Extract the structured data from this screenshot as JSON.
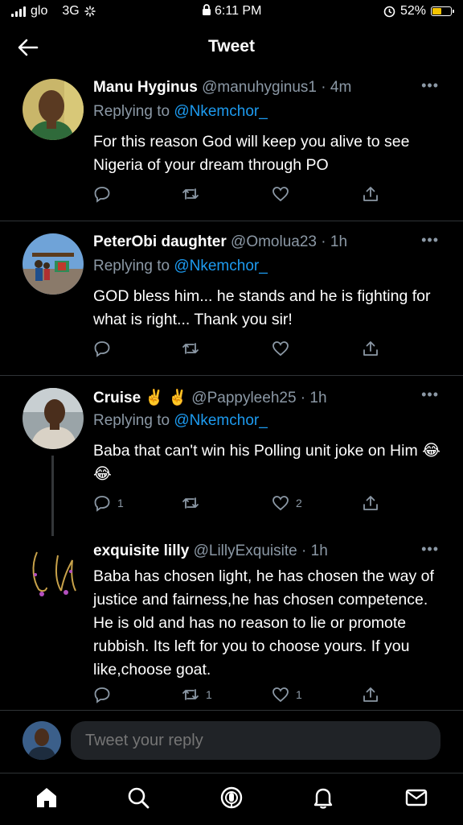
{
  "status": {
    "carrier": "glo",
    "network": "3G",
    "time": "6:11 PM",
    "battery": "52%",
    "battery_level": 0.52
  },
  "header": {
    "title": "Tweet"
  },
  "tweets": [
    {
      "name": "Manu Hyginus",
      "handle": "@manuhyginus1",
      "time": "4m",
      "replying_prefix": "Replying to",
      "replying_to": "@Nkemchor_",
      "text": "For this reason God will keep you alive to see Nigeria of your dream through PO",
      "replies": "",
      "retweets": "",
      "likes": ""
    },
    {
      "name": "PeterObi daughter",
      "handle": "@Omolua23",
      "time": "1h",
      "replying_prefix": "Replying to",
      "replying_to": "@Nkemchor_",
      "text": "GOD bless him... he stands and he is fighting for what is right... Thank you sir!",
      "replies": "",
      "retweets": "",
      "likes": ""
    },
    {
      "name": "Cruise ✌️ ✌️",
      "handle": "@Pappyleeh25",
      "time": "1h",
      "replying_prefix": "Replying to",
      "replying_to": "@Nkemchor_",
      "text": "Baba that can't win his Polling unit joke on Him 😂😂",
      "replies": "1",
      "retweets": "",
      "likes": "2"
    },
    {
      "name": "exquisite lilly",
      "handle": "@LillyExquisite",
      "time": "1h",
      "text": "Baba has chosen light, he has chosen the way of justice and fairness,he has chosen competence. He is old and has no reason to lie or promote rubbish. Its left for you to choose yours. If you like,choose goat.",
      "replies": "",
      "retweets": "1",
      "likes": "1"
    }
  ],
  "reply_box": {
    "placeholder": "Tweet your reply"
  },
  "tabs": [
    "home-icon",
    "search-icon",
    "spaces-icon",
    "notifications-icon",
    "messages-icon"
  ],
  "colors": {
    "accent": "#1d9bf0",
    "muted": "#8b98a5",
    "background": "#000000"
  }
}
